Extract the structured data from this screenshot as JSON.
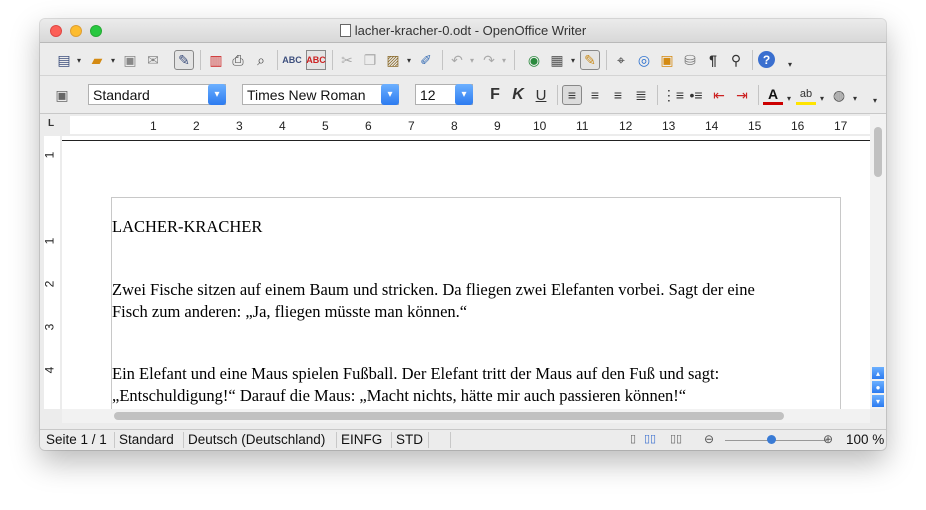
{
  "window": {
    "title": "lacher-kracher-0.odt - OpenOffice Writer"
  },
  "toolbar_standard": {
    "icons": [
      "new-document-icon",
      "open-icon",
      "save-icon",
      "mail-icon",
      "edit-file-icon",
      "export-pdf-icon",
      "print-icon",
      "print-preview-icon",
      "spellcheck-icon",
      "autospellcheck-icon",
      "cut-icon",
      "copy-icon",
      "paste-icon",
      "clone-format-icon",
      "undo-icon",
      "redo-icon",
      "hyperlink-icon",
      "table-icon",
      "show-draw-functions-icon",
      "find-icon",
      "navigator-icon",
      "gallery-icon",
      "data-sources-icon",
      "formatting-marks-icon",
      "zoom-icon",
      "help-icon"
    ]
  },
  "toolbar_formatting": {
    "paragraph_style": "Standard",
    "font_name": "Times New Roman",
    "font_size": "12",
    "bold_label": "F",
    "italic_label": "K",
    "underline_label": "U"
  },
  "ruler": {
    "numbers": [
      "1",
      "2",
      "3",
      "4",
      "5",
      "6",
      "7",
      "8",
      "9",
      "10",
      "11",
      "12",
      "13",
      "14",
      "15",
      "16",
      "17"
    ]
  },
  "vruler": {
    "numbers": [
      "1",
      "1",
      "2",
      "3",
      "4"
    ]
  },
  "document": {
    "heading": "LACHER-KRACHER",
    "p1_line1": "Zwei Fische sitzen auf einem Baum und stricken. Da fliegen zwei Elefanten vorbei. Sagt der eine",
    "p1_line2": "Fisch zum anderen: „Ja, fliegen müsste man können.“",
    "p2_line1": "Ein Elefant und eine Maus spielen Fußball. Der Elefant tritt der Maus auf den Fuß und sagt:",
    "p2_line2": "„Entschuldigung!“ Darauf die Maus: „Macht nichts, hätte mir auch passieren können!“"
  },
  "status": {
    "page": "Seite 1 / 1",
    "style": "Standard",
    "language": "Deutsch (Deutschland)",
    "insert_mode": "EINFG",
    "selection_mode": "STD",
    "zoom": "100 %"
  }
}
